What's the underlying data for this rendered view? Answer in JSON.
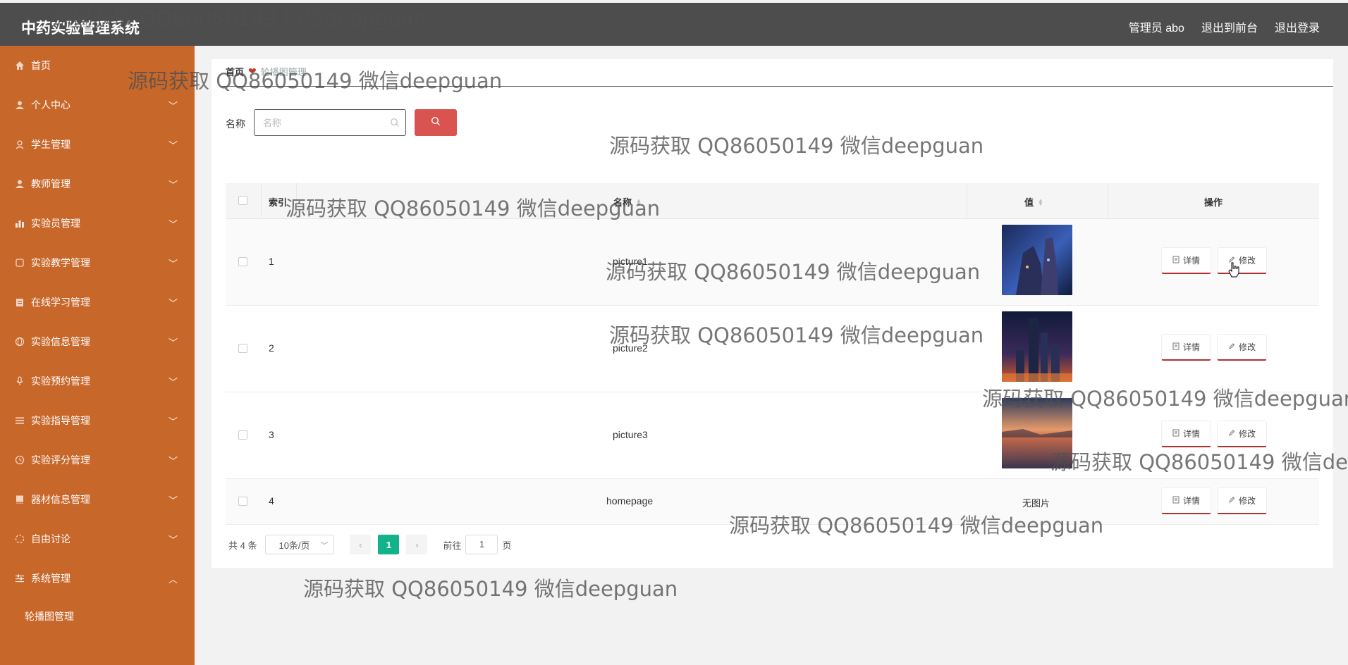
{
  "header": {
    "app_title": "中药实验管理系统",
    "admin_label": "管理员 abo",
    "back_to_front": "退出到前台",
    "logout": "退出登录",
    "bg_color": "#4d4d4d"
  },
  "sidebar": {
    "bg_color": "#c8672a",
    "items": [
      {
        "label": "首页",
        "icon": "home-icon"
      },
      {
        "label": "个人中心",
        "icon": "user-icon"
      },
      {
        "label": "学生管理",
        "icon": "student-icon"
      },
      {
        "label": "教师管理",
        "icon": "user-icon"
      },
      {
        "label": "实验员管理",
        "icon": "bar-chart-icon"
      },
      {
        "label": "实验教学管理",
        "icon": "copy-icon"
      },
      {
        "label": "在线学习管理",
        "icon": "briefcase-icon"
      },
      {
        "label": "实验信息管理",
        "icon": "globe-icon"
      },
      {
        "label": "实验预约管理",
        "icon": "mic-icon"
      },
      {
        "label": "实验指导管理",
        "icon": "list-icon"
      },
      {
        "label": "实验评分管理",
        "icon": "clock-icon"
      },
      {
        "label": "器材信息管理",
        "icon": "book-icon"
      },
      {
        "label": "自由讨论",
        "icon": "loading-icon"
      },
      {
        "label": "系统管理",
        "icon": "sliders-icon"
      }
    ],
    "submenu": {
      "label": "轮播图管理"
    }
  },
  "breadcrumb": {
    "home": "首页",
    "current": "轮播图管理"
  },
  "search": {
    "label": "名称",
    "placeholder": "名称",
    "button_color": "#d9534f"
  },
  "table": {
    "headers": {
      "index": "索引",
      "name": "名称",
      "value": "值",
      "actions": "操作"
    },
    "rows": [
      {
        "index": "1",
        "name": "picture1",
        "value": "image",
        "thumb": "city-night-blue"
      },
      {
        "index": "2",
        "name": "picture2",
        "value": "image",
        "thumb": "city-skyline-dusk"
      },
      {
        "index": "3",
        "name": "picture3",
        "value": "image",
        "thumb": "sunset-reflection"
      },
      {
        "index": "4",
        "name": "homepage",
        "value": "无图片",
        "thumb": ""
      }
    ],
    "detail_label": "详情",
    "edit_label": "修改"
  },
  "pagination": {
    "total": "共 4 条",
    "page_size": "10条/页",
    "current_page": "1",
    "goto_label": "前往",
    "goto_value": "1",
    "page_suffix": "页",
    "active_color": "#12b38a"
  },
  "watermark": {
    "text": "源码获取 QQ86050149 微信deepguan"
  }
}
